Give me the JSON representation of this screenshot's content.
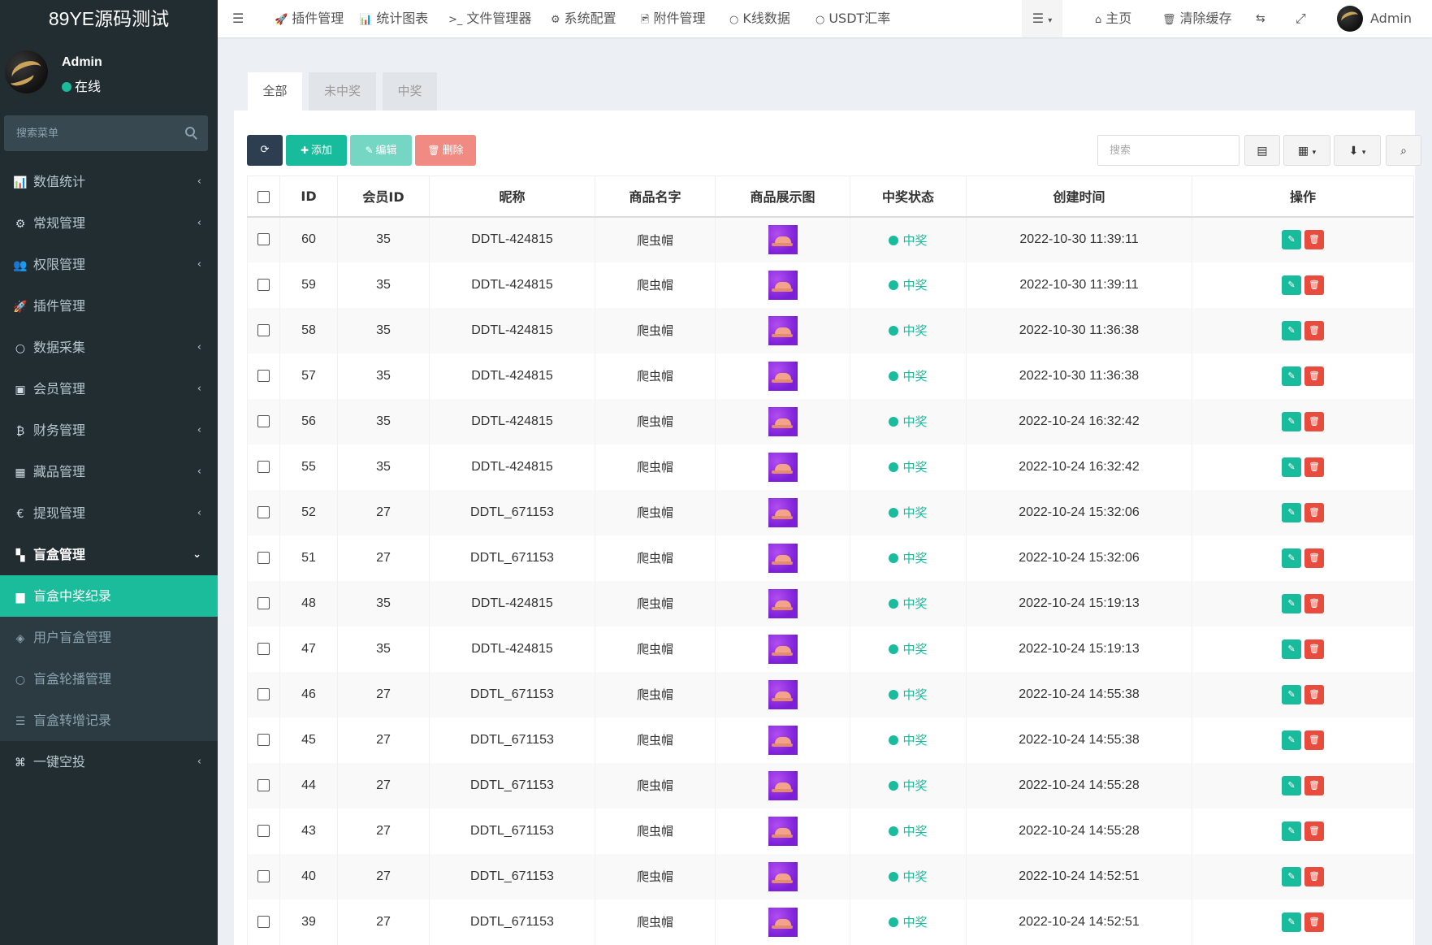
{
  "app": {
    "brand": "89YE源码测试"
  },
  "user": {
    "name": "Admin",
    "status": "在线"
  },
  "sidebar": {
    "search_placeholder": "搜索菜单",
    "items": [
      {
        "label": "数值统计",
        "icon": "bar-chart-icon",
        "glyph": "📊",
        "arrow": "‹",
        "state": "normal"
      },
      {
        "label": "常规管理",
        "icon": "cogs-icon",
        "glyph": "⚙",
        "arrow": "‹",
        "state": "normal"
      },
      {
        "label": "权限管理",
        "icon": "users-icon",
        "glyph": "👥",
        "arrow": "‹",
        "state": "normal"
      },
      {
        "label": "插件管理",
        "icon": "rocket-icon",
        "glyph": "🚀",
        "arrow": "",
        "state": "normal"
      },
      {
        "label": "数据采集",
        "icon": "circle-icon",
        "glyph": "○",
        "arrow": "‹",
        "state": "normal"
      },
      {
        "label": "会员管理",
        "icon": "id-card-icon",
        "glyph": "▣",
        "arrow": "‹",
        "state": "normal"
      },
      {
        "label": "财务管理",
        "icon": "bitcoin-icon",
        "glyph": "₿",
        "arrow": "‹",
        "state": "normal"
      },
      {
        "label": "藏品管理",
        "icon": "calendar-icon",
        "glyph": "▦",
        "arrow": "‹",
        "state": "normal"
      },
      {
        "label": "提现管理",
        "icon": "euro-icon",
        "glyph": "€",
        "arrow": "‹",
        "state": "normal"
      },
      {
        "label": "盲盒管理",
        "icon": "grid-icon",
        "glyph": "▚",
        "arrow": "⌄",
        "state": "open"
      },
      {
        "label": "盲盒中奖纪录",
        "icon": "book-icon",
        "glyph": "▆",
        "arrow": "",
        "state": "active"
      },
      {
        "label": "用户盲盒管理",
        "icon": "cube-icon",
        "glyph": "◈",
        "arrow": "",
        "state": "sub"
      },
      {
        "label": "盲盒轮播管理",
        "icon": "circle-icon",
        "glyph": "○",
        "arrow": "",
        "state": "sub"
      },
      {
        "label": "盲盒转增记录",
        "icon": "list-icon",
        "glyph": "☰",
        "arrow": "",
        "state": "sub"
      },
      {
        "label": "一键空投",
        "icon": "crosshair-icon",
        "glyph": "⌘",
        "arrow": "‹",
        "state": "normal"
      }
    ]
  },
  "topbar": {
    "nav": [
      {
        "label": "插件管理",
        "icon": "rocket-icon",
        "glyph": "🚀"
      },
      {
        "label": "统计图表",
        "icon": "bar-chart-icon",
        "glyph": "📊"
      },
      {
        "label": "文件管理器",
        "icon": "terminal-icon",
        "glyph": ">_"
      },
      {
        "label": "系统配置",
        "icon": "gear-icon",
        "glyph": "⚙"
      },
      {
        "label": "附件管理",
        "icon": "file-image-icon",
        "glyph": "🖻"
      },
      {
        "label": "K线数据",
        "icon": "circle-icon",
        "glyph": "○"
      },
      {
        "label": "USDT汇率",
        "icon": "circle-icon",
        "glyph": "○"
      }
    ],
    "home": "主页",
    "clear_cache": "清除缓存",
    "admin_name": "Admin"
  },
  "tabs": [
    "全部",
    "未中奖",
    "中奖"
  ],
  "toolbar": {
    "add": "添加",
    "edit": "编辑",
    "delete": "删除",
    "search_placeholder": "搜索"
  },
  "table": {
    "columns": [
      "",
      "ID",
      "会员ID",
      "昵称",
      "商品名字",
      "商品展示图",
      "中奖状态",
      "创建时间",
      "操作"
    ],
    "rows": [
      {
        "id": "60",
        "member_id": "35",
        "nickname": "DDTL-424815",
        "product": "爬虫帽",
        "status": "中奖",
        "created": "2022-10-30 11:39:11"
      },
      {
        "id": "59",
        "member_id": "35",
        "nickname": "DDTL-424815",
        "product": "爬虫帽",
        "status": "中奖",
        "created": "2022-10-30 11:39:11"
      },
      {
        "id": "58",
        "member_id": "35",
        "nickname": "DDTL-424815",
        "product": "爬虫帽",
        "status": "中奖",
        "created": "2022-10-30 11:36:38"
      },
      {
        "id": "57",
        "member_id": "35",
        "nickname": "DDTL-424815",
        "product": "爬虫帽",
        "status": "中奖",
        "created": "2022-10-30 11:36:38"
      },
      {
        "id": "56",
        "member_id": "35",
        "nickname": "DDTL-424815",
        "product": "爬虫帽",
        "status": "中奖",
        "created": "2022-10-24 16:32:42"
      },
      {
        "id": "55",
        "member_id": "35",
        "nickname": "DDTL-424815",
        "product": "爬虫帽",
        "status": "中奖",
        "created": "2022-10-24 16:32:42"
      },
      {
        "id": "52",
        "member_id": "27",
        "nickname": "DDTL_671153",
        "product": "爬虫帽",
        "status": "中奖",
        "created": "2022-10-24 15:32:06"
      },
      {
        "id": "51",
        "member_id": "27",
        "nickname": "DDTL_671153",
        "product": "爬虫帽",
        "status": "中奖",
        "created": "2022-10-24 15:32:06"
      },
      {
        "id": "48",
        "member_id": "35",
        "nickname": "DDTL-424815",
        "product": "爬虫帽",
        "status": "中奖",
        "created": "2022-10-24 15:19:13"
      },
      {
        "id": "47",
        "member_id": "35",
        "nickname": "DDTL-424815",
        "product": "爬虫帽",
        "status": "中奖",
        "created": "2022-10-24 15:19:13"
      },
      {
        "id": "46",
        "member_id": "27",
        "nickname": "DDTL_671153",
        "product": "爬虫帽",
        "status": "中奖",
        "created": "2022-10-24 14:55:38"
      },
      {
        "id": "45",
        "member_id": "27",
        "nickname": "DDTL_671153",
        "product": "爬虫帽",
        "status": "中奖",
        "created": "2022-10-24 14:55:38"
      },
      {
        "id": "44",
        "member_id": "27",
        "nickname": "DDTL_671153",
        "product": "爬虫帽",
        "status": "中奖",
        "created": "2022-10-24 14:55:28"
      },
      {
        "id": "43",
        "member_id": "27",
        "nickname": "DDTL_671153",
        "product": "爬虫帽",
        "status": "中奖",
        "created": "2022-10-24 14:55:28"
      },
      {
        "id": "40",
        "member_id": "27",
        "nickname": "DDTL_671153",
        "product": "爬虫帽",
        "status": "中奖",
        "created": "2022-10-24 14:52:51"
      },
      {
        "id": "39",
        "member_id": "27",
        "nickname": "DDTL_671153",
        "product": "爬虫帽",
        "status": "中奖",
        "created": "2022-10-24 14:52:51"
      }
    ]
  },
  "colors": {
    "accent": "#18bc9c",
    "sidebar_bg": "#222d32",
    "danger": "#e74c3c",
    "dark_button": "#2c3e50"
  }
}
